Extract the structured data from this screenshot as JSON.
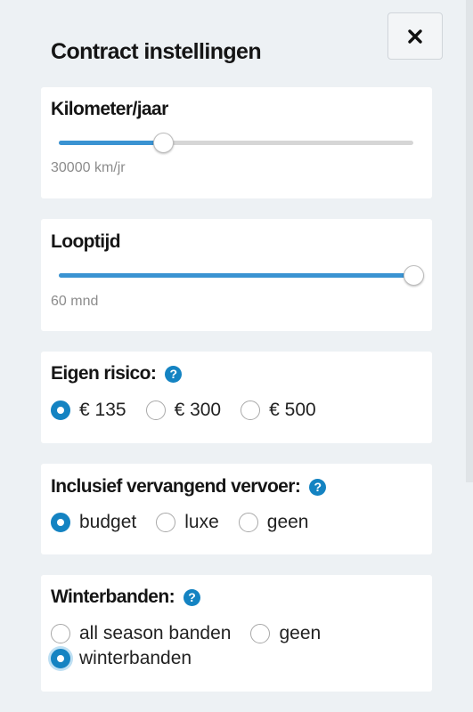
{
  "header": {
    "title": "Contract instellingen",
    "close_icon": "close-icon"
  },
  "sections": {
    "kilometers": {
      "title": "Kilometer/jaar",
      "value_text": "30000 km/jr",
      "slider_fraction": 0.295
    },
    "looptijd": {
      "title": "Looptijd",
      "value_text": "60 mnd",
      "slider_fraction": 1.0
    },
    "eigen_risico": {
      "title": "Eigen risico:",
      "help": "?",
      "options": [
        "€ 135",
        "€ 300",
        "€ 500"
      ],
      "selected": "€ 135"
    },
    "vervangend_vervoer": {
      "title": "Inclusief vervangend vervoer:",
      "help": "?",
      "options": [
        "budget",
        "luxe",
        "geen"
      ],
      "selected": "budget"
    },
    "winterbanden": {
      "title": "Winterbanden:",
      "help": "?",
      "options": [
        "all season banden",
        "geen",
        "winterbanden"
      ],
      "selected": "winterbanden"
    }
  },
  "colors": {
    "accent": "#1483c2",
    "slider_fill": "#3a93d2",
    "background": "#edf1f4"
  }
}
